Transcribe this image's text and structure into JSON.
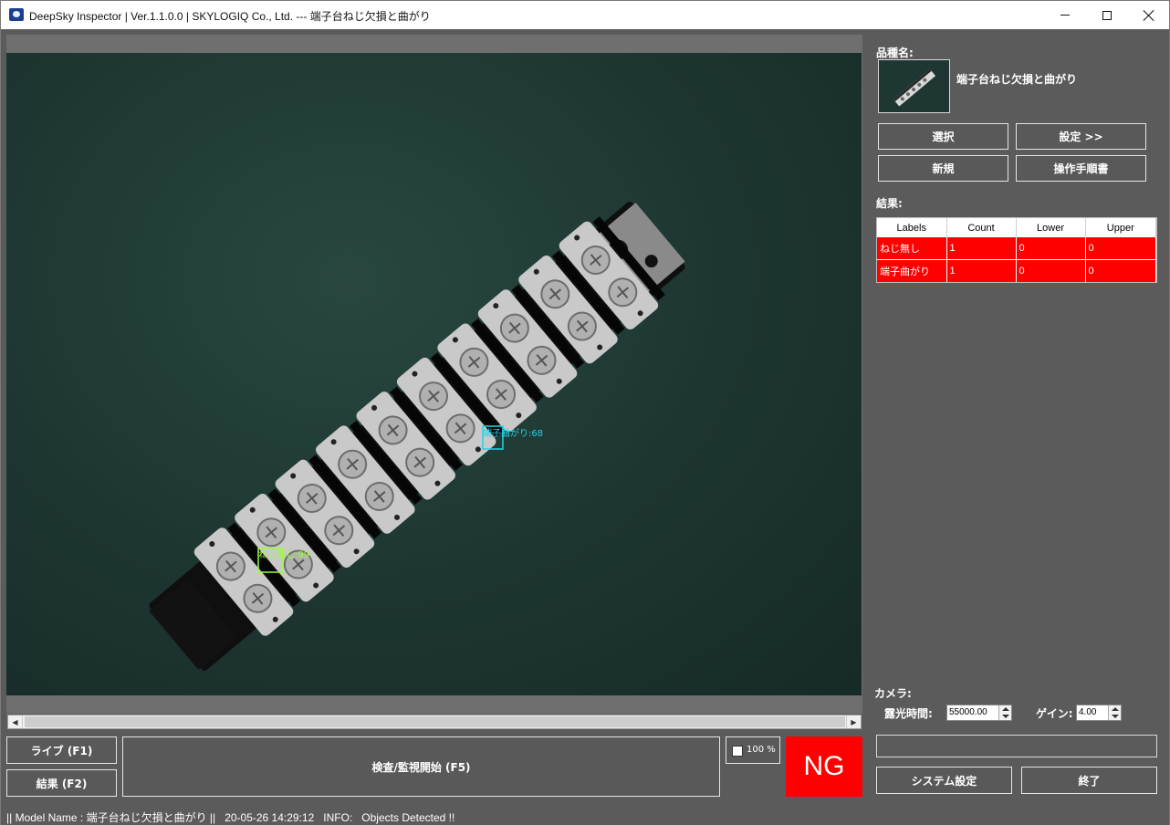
{
  "window": {
    "title": "DeepSky Inspector | Ver.1.1.0.0 | SKYLOGIQ Co., Ltd. --- 端子台ねじ欠損と曲がり"
  },
  "viewer": {
    "detections": [
      {
        "label": "ねじ無し",
        "score": "99",
        "text": "ねじ無し:99",
        "color": "#9aff32"
      },
      {
        "label": "端子曲がり",
        "score": "68",
        "text": "端子曲がり:68",
        "color": "#22d3e6"
      }
    ]
  },
  "controls": {
    "live_label": "ライブ (F1)",
    "result_label": "結果 (F2)",
    "inspect_label": "検査/監視開始 (F5)",
    "zoom_label": "100 %",
    "judgement": "NG",
    "judgement_color": "#ff0000"
  },
  "panel": {
    "model_label": "品種名:",
    "model_name": "端子台ねじ欠損と曲がり",
    "select_label": "選択",
    "settings_label": "設定 >>",
    "new_label": "新規",
    "manual_label": "操作手順書",
    "results_label": "結果:",
    "table": {
      "headers": [
        "Labels",
        "Count",
        "Lower",
        "Upper"
      ],
      "rows": [
        [
          "ねじ無し",
          "1",
          "0",
          "0"
        ],
        [
          "端子曲がり",
          "1",
          "0",
          "0"
        ]
      ]
    },
    "camera_label": "カメラ:",
    "exposure_label": "露光時間:",
    "exposure_value": "55000.00",
    "gain_label": "ゲイン:",
    "gain_value": "4.00",
    "system_settings_label": "システム設定",
    "exit_label": "終了"
  },
  "status": {
    "model": "|| Model Name : 端子台ねじ欠損と曲がり ||",
    "timestamp": "20-05-26 14:29:12",
    "info": "INFO:   Objects Detected !!"
  }
}
